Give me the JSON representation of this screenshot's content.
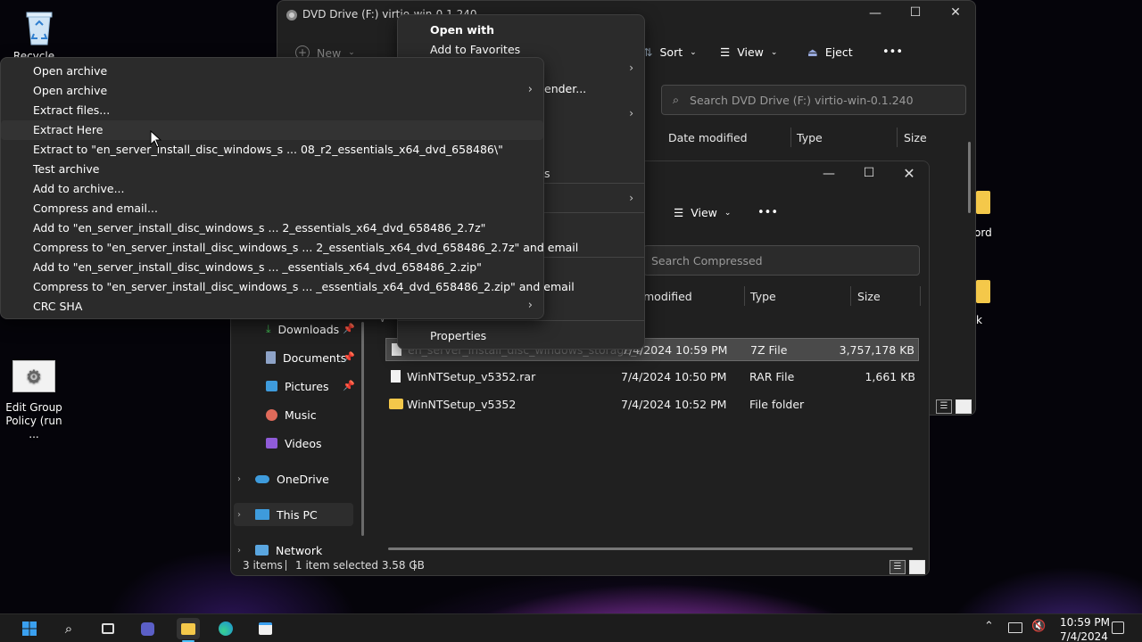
{
  "desktop": {
    "recycle_bin_label": "Recycle Bin",
    "group_policy_label_1": "Edit Group",
    "group_policy_label_2": "Policy (run ...",
    "right_label_1": "ord",
    "right_label_2": "k"
  },
  "back_window": {
    "title": "DVD Drive (F:) virtio-win-0.1.240",
    "new_label": "New",
    "sort_label": "Sort",
    "view_label": "View",
    "eject_label": "Eject",
    "more_label": "•••",
    "search_placeholder": "Search DVD Drive (F:) virtio-win-0.1.240",
    "columns": {
      "date": "Date modified",
      "type": "Type",
      "size": "Size"
    }
  },
  "front_window": {
    "view_label": "View",
    "more_label": "•••",
    "search_placeholder": "Search Compressed",
    "columns": {
      "date": "modified",
      "type": "Type",
      "size": "Size"
    },
    "nav": {
      "downloads": "Downloads",
      "documents": "Documents",
      "pictures": "Pictures",
      "music": "Music",
      "videos": "Videos",
      "onedrive": "OneDrive",
      "this_pc": "This PC",
      "network": "Network"
    },
    "files": [
      {
        "name": "en_server_install_disc_windows_storage_s...",
        "date": "7/4/2024 10:59 PM",
        "type": "7Z File",
        "size": "3,757,178 KB"
      },
      {
        "name": "WinNTSetup_v5352.rar",
        "date": "7/4/2024 10:50 PM",
        "type": "RAR File",
        "size": "1,661 KB"
      },
      {
        "name": "WinNTSetup_v5352",
        "date": "7/4/2024 10:52 PM",
        "type": "File folder",
        "size": ""
      }
    ],
    "status": {
      "items": "3 items",
      "selected": "1 item selected  3.58 GB"
    }
  },
  "context_menu": {
    "open_with": "Open with",
    "add_favorites": "Add to Favorites",
    "partial_defender": "ender...",
    "partial_s": "s",
    "properties": "Properties"
  },
  "zip_menu": {
    "items": [
      {
        "label": "Open archive",
        "submenu": false
      },
      {
        "label": "Open archive",
        "submenu": true
      },
      {
        "label": "Extract files...",
        "submenu": false
      },
      {
        "label": "Extract Here",
        "submenu": false
      },
      {
        "label": "Extract to \"en_server_install_disc_windows_s ... 08_r2_essentials_x64_dvd_658486\\\"",
        "submenu": false
      },
      {
        "label": "Test archive",
        "submenu": false
      },
      {
        "label": "Add to archive...",
        "submenu": false
      },
      {
        "label": "Compress and email...",
        "submenu": false
      },
      {
        "label": "Add to \"en_server_install_disc_windows_s ... 2_essentials_x64_dvd_658486_2.7z\"",
        "submenu": false
      },
      {
        "label": "Compress to \"en_server_install_disc_windows_s ... 2_essentials_x64_dvd_658486_2.7z\" and email",
        "submenu": false
      },
      {
        "label": "Add to \"en_server_install_disc_windows_s ... _essentials_x64_dvd_658486_2.zip\"",
        "submenu": false
      },
      {
        "label": "Compress to \"en_server_install_disc_windows_s ... _essentials_x64_dvd_658486_2.zip\" and email",
        "submenu": false
      },
      {
        "label": "CRC SHA",
        "submenu": true
      }
    ]
  },
  "taskbar": {
    "time": "10:59 PM",
    "date": "7/4/2024"
  },
  "colors": {
    "window_bg": "#202020",
    "menu_bg": "#2b2b2b",
    "accent": "#4cc2ff",
    "folder": "#f4c84a"
  }
}
